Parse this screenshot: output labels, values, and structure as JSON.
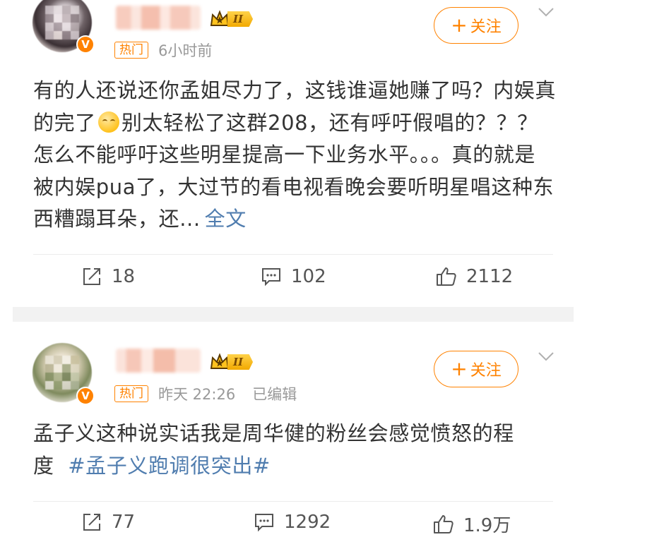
{
  "posts": [
    {
      "hot_label": "热门",
      "time": "6小时前",
      "edited": "",
      "level": "II",
      "follow_label": "关注",
      "text_1": "有的人还说还你孟姐尽力了，这钱谁逼她赚了吗？内娱真的完了",
      "text_2": "别太轻松了这群208，还有呼吁假唱的？？？ 怎么不能呼吁这些明星提高一下业务水平。。。真的就是被内娱pua了，大过节的看电视看晚会要听明星唱这种东西糟蹋耳朵，还...",
      "more_label": "全文",
      "emoji": "smile-emoji",
      "repost_count": "18",
      "comment_count": "102",
      "like_count": "2112"
    },
    {
      "hot_label": "热门",
      "time": "昨天 22:26",
      "edited": "已编辑",
      "level": "II",
      "follow_label": "关注",
      "text_1": "孟子义这种说实话我是周华健的粉丝会感觉愤怒的程度",
      "topic": "#孟子义跑调很突出#",
      "repost_count": "77",
      "comment_count": "1292",
      "like_count": "1.9万"
    }
  ],
  "colors": {
    "accent": "#ff8200",
    "link": "#507daf",
    "text": "#333333",
    "meta": "#999999",
    "gap": "#f2f2f2"
  },
  "icons": [
    "repost-icon",
    "comment-icon",
    "like-icon",
    "chevron-down-icon",
    "verified-badge-icon",
    "crown-level-icon"
  ]
}
